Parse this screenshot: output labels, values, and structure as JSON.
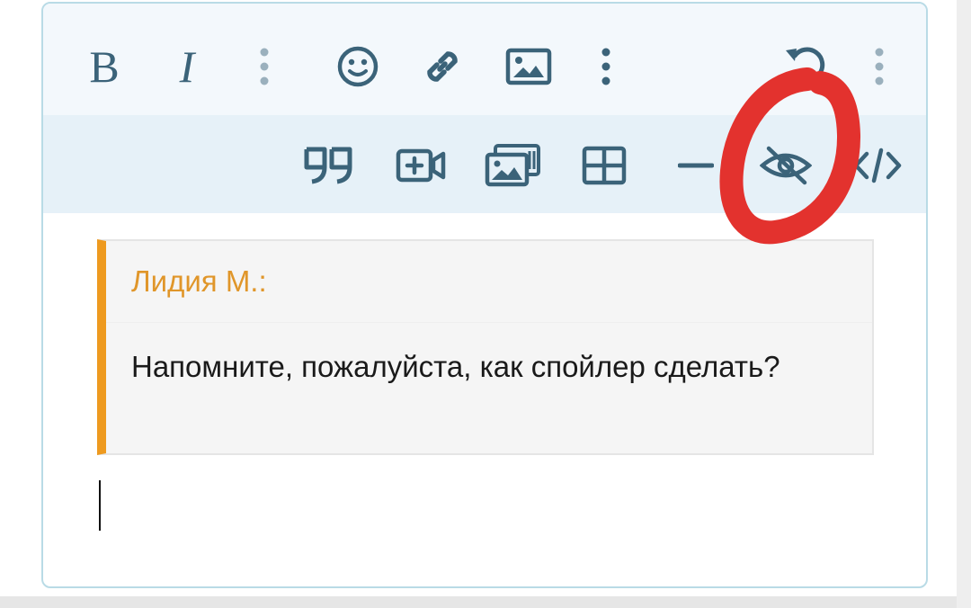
{
  "toolbar": {
    "row1": [
      {
        "name": "bold-button",
        "label": "B",
        "icon": "bold-icon"
      },
      {
        "name": "italic-button",
        "label": "I",
        "icon": "italic-icon"
      },
      {
        "name": "more-text-options-button",
        "icon": "vertical-dots-icon"
      },
      {
        "name": "emoji-button",
        "icon": "smiley-icon"
      },
      {
        "name": "link-button",
        "icon": "link-icon"
      },
      {
        "name": "image-button",
        "icon": "image-icon"
      },
      {
        "name": "more-insert-options-button",
        "icon": "vertical-dots-icon"
      },
      {
        "name": "undo-button",
        "icon": "undo-icon"
      },
      {
        "name": "more-options-button",
        "icon": "vertical-dots-icon"
      }
    ],
    "row2": [
      {
        "name": "quote-button",
        "icon": "quote-icon"
      },
      {
        "name": "insert-media-button",
        "icon": "video-plus-icon"
      },
      {
        "name": "gallery-button",
        "icon": "gallery-icon"
      },
      {
        "name": "table-button",
        "icon": "table-icon"
      },
      {
        "name": "horizontal-line-button",
        "icon": "minus-icon"
      },
      {
        "name": "spoiler-button",
        "icon": "eye-slash-icon"
      },
      {
        "name": "source-code-button",
        "icon": "code-icon"
      }
    ]
  },
  "quote": {
    "author": "Лидия М.:",
    "text": "Напомните, пожалуйста, как спойлер сделать?"
  },
  "colors": {
    "icon": "#3b6379",
    "toolbar_row1_bg": "#f3f8fc",
    "toolbar_row2_bg": "#e6f1f8",
    "editor_border": "#b9dbe6",
    "quote_accent": "#ee9a1f",
    "quote_author": "#e0962a",
    "annotation": "#e3322e"
  }
}
